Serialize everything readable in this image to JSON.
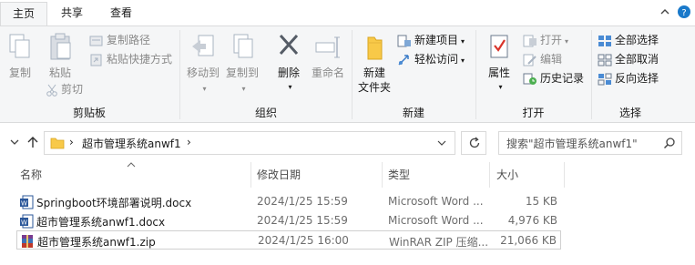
{
  "ribbon_tabs": [
    "主页",
    "共享",
    "查看"
  ],
  "clipboard": {
    "copy": "复制",
    "paste": "粘贴",
    "copy_path": "复制路径",
    "paste_shortcut": "粘贴快捷方式",
    "cut": "剪切",
    "group": "剪贴板"
  },
  "organize": {
    "move_to": "移动到",
    "copy_to": "复制到",
    "delete": "删除",
    "rename": "重命名",
    "group": "组织"
  },
  "new_group": {
    "new_folder_1": "新建",
    "new_folder_2": "文件夹",
    "new_item": "新建项目",
    "easy_access": "轻松访问",
    "group": "新建"
  },
  "open_group": {
    "properties": "属性",
    "open": "打开",
    "edit": "编辑",
    "history": "历史记录",
    "group": "打开"
  },
  "select_group": {
    "select_all": "全部选择",
    "select_none": "全部取消",
    "invert": "反向选择",
    "group": "选择"
  },
  "address": {
    "folder": "超市管理系统anwf1"
  },
  "search": {
    "placeholder": "搜索\"超市管理系统anwf1\""
  },
  "columns": {
    "name": "名称",
    "modified": "修改日期",
    "type": "类型",
    "size": "大小"
  },
  "files": [
    {
      "name": "Springboot环境部署说明.docx",
      "modified": "2024/1/25 15:59",
      "type": "Microsoft Word ...",
      "size": "15 KB",
      "icon": "word-icon"
    },
    {
      "name": "超市管理系统anwf1.docx",
      "modified": "2024/1/25 15:59",
      "type": "Microsoft Word ...",
      "size": "4,976 KB",
      "icon": "word-icon"
    },
    {
      "name": "超市管理系统anwf1.zip",
      "modified": "2024/1/25 16:00",
      "type": "WinRAR ZIP 压缩...",
      "size": "21,066 KB",
      "icon": "winrar-icon"
    }
  ],
  "colors": {
    "accent": "#1979ca",
    "folder": "#f8c948",
    "word": "#2b579a",
    "delete_red": "#c0392b"
  }
}
